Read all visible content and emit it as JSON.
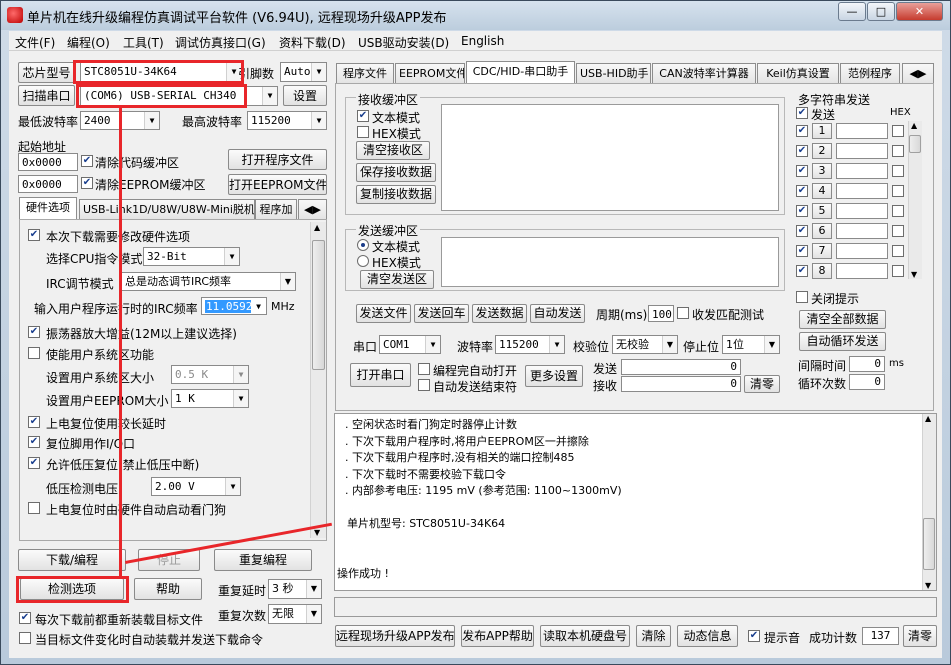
{
  "window": {
    "title": "单片机在线升级编程仿真调试平台软件 (V6.94U), 远程现场升级APP发布",
    "buttons": {
      "minimize": "—",
      "maximize": "□",
      "close": "✕"
    }
  },
  "menu": [
    "文件(F)",
    "编程(O)",
    "工具(T)",
    "调试仿真接口(G)",
    "资料下载(D)",
    "USB驱动安装(D)",
    "English"
  ],
  "left": {
    "chip_model_button": "芯片型号",
    "chip_model_value": "STC8051U-34K64",
    "pin_count_label": "引脚数",
    "pin_count_value": "Auto",
    "scan_port_button": "扫描串口",
    "port_value": "(COM6) USB-SERIAL CH340",
    "settings_button": "设置",
    "min_baud_label": "最低波特率",
    "min_baud_value": "2400",
    "max_baud_label": "最高波特率",
    "max_baud_value": "115200",
    "start_addr_label": "起始地址",
    "code_addr": "0x0000",
    "clear_code_label": "清除代码缓冲区",
    "open_program_button": "打开程序文件",
    "eeprom_addr": "0x0000",
    "clear_eeprom_label": "清除EEPROM缓冲区",
    "open_eeprom_button": "打开EEPROM文件",
    "tabs": [
      "硬件选项",
      "USB-Link1D/U8W/U8W-Mini脱机",
      "程序加"
    ],
    "hw": {
      "need_modify": "本次下载需要修改硬件选项",
      "cpu_mode_label": "选择CPU指令模式",
      "cpu_mode_value": "32-Bit",
      "irc_mode_label": "IRC调节模式",
      "irc_mode_value": "总是动态调节IRC频率",
      "irc_freq_label": "输入用户程序运行时的IRC频率",
      "irc_freq_value": "11.0592",
      "irc_freq_unit": "MHz",
      "osc_amp": "振荡器放大增益(12M以上建议选择)",
      "use_sys_area": "使能用户系统区功能",
      "sys_area_size_label": "设置用户系统区大小",
      "sys_area_size_value": "0.5 K",
      "eeprom_size_label": "设置用户EEPROM大小",
      "eeprom_size_value": "1   K",
      "long_reset_delay": "上电复位使用较长延时",
      "reset_pin_io": "复位脚用作I/O口",
      "low_volt_reset": "允许低压复位(禁止低压中断)",
      "low_volt_label": "低压检测电压",
      "low_volt_value": "2.00 V",
      "watchdog": "上电复位时由硬件自动启动看门狗"
    },
    "download_button": "下载/编程",
    "stop_button": "停止",
    "reprogram_button": "重复编程",
    "check_options_button": "检测选项",
    "help_button": "帮助",
    "repeat_delay_label": "重复延时",
    "repeat_delay_value": "3 秒",
    "repeat_count_label": "重复次数",
    "repeat_count_value": "无限",
    "reload_target_label": "每次下载前都重新装载目标文件",
    "auto_load_label": "当目标文件变化时自动装载并发送下载命令"
  },
  "right": {
    "tabs": [
      "程序文件",
      "EEPROM文件",
      "CDC/HID-串口助手",
      "USB-HID助手",
      "CAN波特率计算器",
      "Keil仿真设置",
      "范例程序"
    ],
    "receive": {
      "title": "接收缓冲区",
      "text_mode": "文本模式",
      "hex_mode": "HEX模式",
      "clear_button": "清空接收区",
      "save_button": "保存接收数据",
      "copy_button": "复制接收数据"
    },
    "send": {
      "title": "发送缓冲区",
      "text_mode": "文本模式",
      "hex_mode": "HEX模式",
      "clear_button": "清空发送区"
    },
    "send_file_button": "发送文件",
    "send_enter_button": "发送回车",
    "send_data_button": "发送数据",
    "auto_send_button": "自动发送",
    "period_label": "周期(ms)",
    "period_value": "100",
    "match_label": "收发匹配测试",
    "port_label": "串口",
    "port_value": "COM1",
    "baud_label": "波特率",
    "baud_value": "115200",
    "parity_label": "校验位",
    "parity_value": "无校验",
    "stopbit_label": "停止位",
    "stopbit_value": "1位",
    "open_port_button": "打开串口",
    "auto_open_label": "编程完自动打开",
    "auto_end_label": "自动发送结束符",
    "more_settings_button": "更多设置",
    "tx_label": "发送",
    "tx_value": "0",
    "rx_label": "接收",
    "rx_value": "0",
    "clear_count_button": "清零",
    "multi": {
      "title": "多字符串发送",
      "send_col": "发送",
      "hex_col": "HEX",
      "rows": [
        "1",
        "2",
        "3",
        "4",
        "5",
        "6",
        "7",
        "8"
      ],
      "close_hint": "关闭提示",
      "clear_all_button": "清空全部数据",
      "auto_loop_button": "自动循环发送",
      "interval_label": "间隔时间",
      "interval_value": "0",
      "interval_unit": "ms",
      "loop_count_label": "循环次数",
      "loop_count_value": "0"
    },
    "log": [
      ". 空闲状态时看门狗定时器停止计数",
      ". 下次下载用户程序时,将用户EEPROM区一并擦除",
      ". 下次下载用户程序时,没有相关的端口控制485",
      ". 下次下载时不需要校验下载口令",
      ". 内部参考电压: 1195 mV (参考范围: 1100~1300mV)",
      "",
      "单片机型号: STC8051U-34K64",
      "",
      "",
      "操作成功 !"
    ],
    "bottom": {
      "publish_app": "远程现场升级APP发布",
      "publish_help": "发布APP帮助",
      "read_disk_id": "读取本机硬盘号",
      "clear": "清除",
      "animation": "动态信息",
      "beep_label": "提示音",
      "success_label": "成功计数",
      "success_value": "137",
      "clear_count": "清零"
    }
  },
  "colors": {
    "highlight": "#e8262a",
    "selection": "#3399ff"
  }
}
